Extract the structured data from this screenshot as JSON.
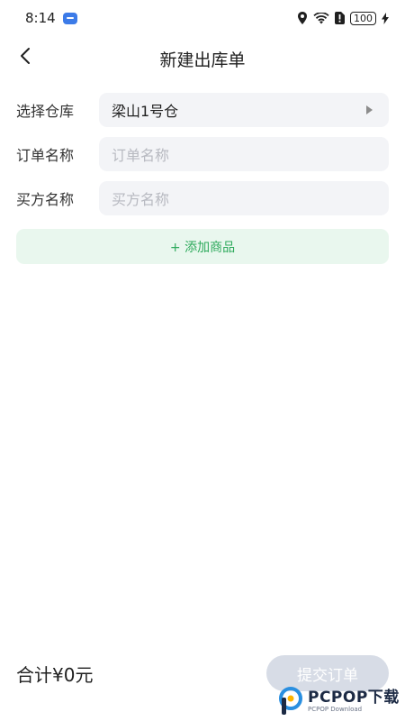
{
  "status_bar": {
    "time": "8:14",
    "battery": "100"
  },
  "header": {
    "title": "新建出库单"
  },
  "form": {
    "warehouse": {
      "label": "选择仓库",
      "value": "梁山1号仓"
    },
    "order_name": {
      "label": "订单名称",
      "placeholder": "订单名称"
    },
    "buyer_name": {
      "label": "买方名称",
      "placeholder": "买方名称"
    }
  },
  "add_product_label": "+ 添加商品",
  "footer": {
    "total": "合计¥0元",
    "submit_label": "提交订单"
  },
  "watermark": {
    "title": "PCPOP下载",
    "subtitle": "PCPOP Download"
  },
  "colors": {
    "accent_green": "#2eaa5c",
    "add_bg": "#e9f7ee",
    "field_bg": "#f3f4f7",
    "submit_disabled": "#d7dce6"
  }
}
